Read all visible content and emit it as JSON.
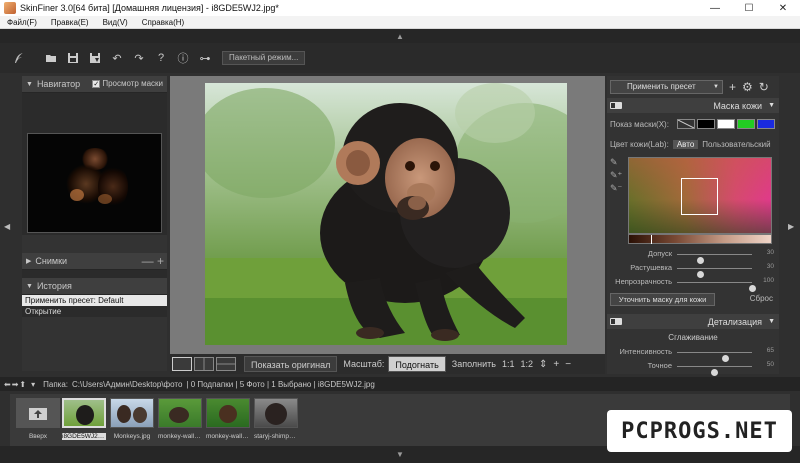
{
  "window": {
    "title": "SkinFiner 3.0[64 бита] [Домашняя лицензия] - i8GDE5WJ2.jpg*",
    "controls": [
      "—",
      "☐",
      "✕"
    ]
  },
  "menu": [
    "Файл(F)",
    "Правка(E)",
    "Вид(V)",
    "Справка(H)"
  ],
  "toolbar": {
    "icons": [
      "feather-icon",
      "open-folder-icon",
      "save-icon",
      "save-as-icon",
      "undo-icon",
      "redo-icon",
      "help-icon",
      "info-icon",
      "plugin-icon"
    ],
    "batch_label": "Пакетный режим..."
  },
  "left": {
    "navigator": {
      "title": "Навигатор",
      "mask_preview_label": "Просмотр маски",
      "mask_preview_checked": true
    },
    "snapshots": {
      "title": "Снимки"
    },
    "history": {
      "title": "История",
      "items": [
        {
          "label": "Применить пресет: Default",
          "active": true
        },
        {
          "label": "Открытие",
          "active": false
        }
      ]
    }
  },
  "viewbar": {
    "show_original": "Показать оригинал",
    "scale_label": "Масштаб:",
    "fit": "Подогнать",
    "fill": "Заполнить",
    "one_to_one": "1:1",
    "one_to_two": "1:2"
  },
  "right": {
    "preset_button": "Применить пресет",
    "skin_mask": {
      "title": "Маска кожи",
      "show_mask_label": "Показ маски(X):",
      "mask_colors": [
        "#000000",
        "#ffffff",
        "#22cc22",
        "#1a2adf"
      ],
      "skin_color_label": "Цвет кожи(Lab):",
      "tabs": [
        "Авто",
        "Пользовательский"
      ],
      "active_tab": "Авто",
      "sliders": [
        {
          "label": "Допуск",
          "value": "30",
          "fraction": 0.31
        },
        {
          "label": "Растушевка",
          "value": "30",
          "fraction": 0.31
        },
        {
          "label": "Непрозрачность",
          "value": "100",
          "fraction": 1.0
        }
      ],
      "refine_button": "Уточнить маску для кожи",
      "reset_label": "Сброс"
    },
    "detail": {
      "title": "Детализация",
      "section": "Сглаживание",
      "sliders": [
        {
          "label": "Интенсивность",
          "value": "65",
          "fraction": 0.65
        },
        {
          "label": "Точное",
          "value": "50",
          "fraction": 0.5
        }
      ]
    }
  },
  "pathbar": {
    "folder_label": "Папка:",
    "path": "C:\\Users\\Админ\\Desktop\\фото",
    "stats": "| 0 Подпапки | 5 Фото | 1 Выбрано | i8GDE5WJ2.jpg"
  },
  "filmstrip": {
    "up_label": "Вверх",
    "items": [
      {
        "name": "i8GDE5WJ2.jpg",
        "selected": true
      },
      {
        "name": "Monkeys.jpg",
        "selected": false
      },
      {
        "name": "monkey-wallp...",
        "selected": false
      },
      {
        "name": "monkey-wallp...",
        "selected": false
      },
      {
        "name": "staryj-shimpa...",
        "selected": false
      }
    ]
  },
  "watermark": "PCPROGS.NET"
}
